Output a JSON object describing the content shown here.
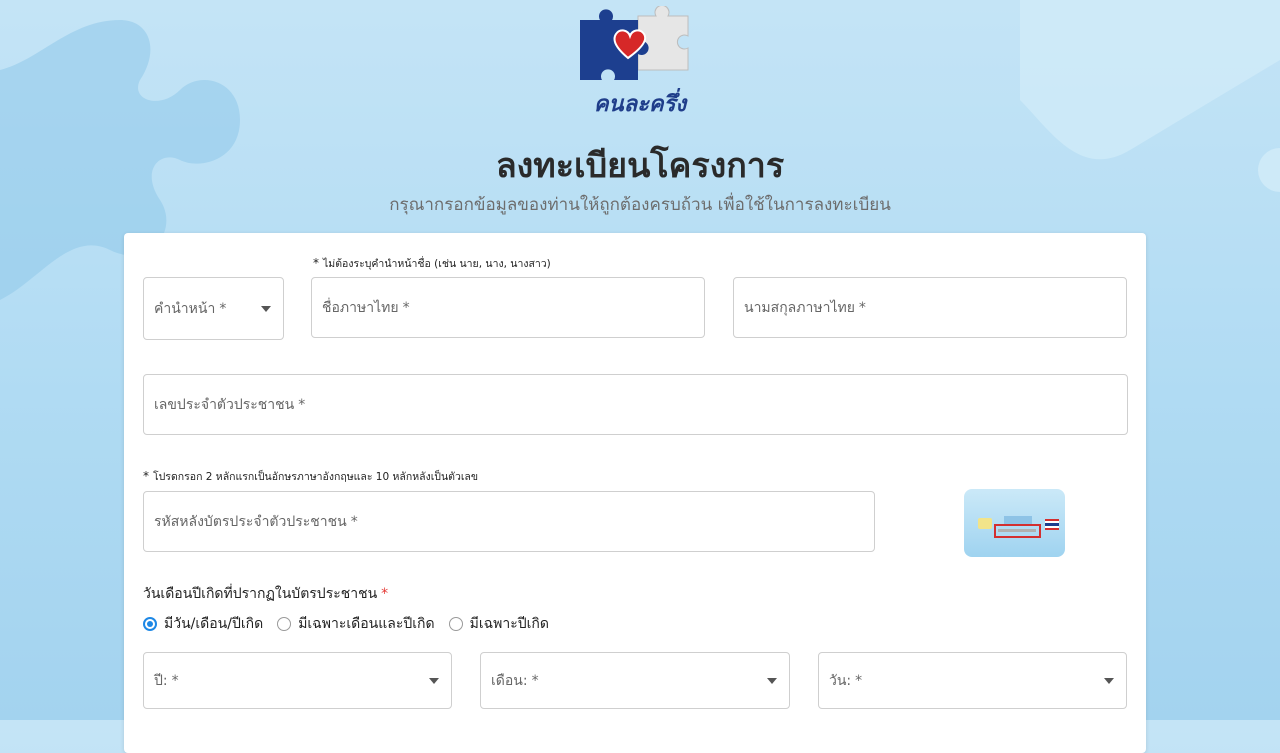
{
  "brand": {
    "name": "คนละครึ่ง"
  },
  "header": {
    "title": "ลงทะเบียนโครงการ",
    "subtitle": "กรุณากรอกข้อมูลของท่านให้ถูกต้องครบถ้วน เพื่อใช้ในการลงทะเบียน"
  },
  "form": {
    "name_hint": "ไม่ต้องระบุคำนำหน้าชื่อ (เช่น นาย, นาง, นางสาว)",
    "prefix": {
      "label": "คำนำหน้า",
      "required": "*"
    },
    "first_name": {
      "label": "ชื่อภาษาไทย",
      "required": "*"
    },
    "last_name": {
      "label": "นามสกุลภาษาไทย",
      "required": "*"
    },
    "citizen_id": {
      "label": "เลขประจำตัวประชาชน",
      "required": "*"
    },
    "laser_hint": "โปรดกรอก 2 หลักแรกเป็นอักษรภาษาอังกฤษและ 10 หลักหลังเป็นตัวเลข",
    "laser_code": {
      "label": "รหัสหลังบัตรประจำตัวประชาชน",
      "required": "*"
    },
    "dob_section": {
      "label": "วันเดือนปีเกิดที่ปรากฏในบัตรประชาชน",
      "required": "*"
    },
    "dob_options": [
      {
        "label": "มีวัน/เดือน/ปีเกิด",
        "checked": true
      },
      {
        "label": "มีเฉพาะเดือนและปีเกิด",
        "checked": false
      },
      {
        "label": "มีเฉพาะปีเกิด",
        "checked": false
      }
    ],
    "year": {
      "label": "ปี:",
      "required": "*"
    },
    "month": {
      "label": "เดือน:",
      "required": "*"
    },
    "day": {
      "label": "วัน:",
      "required": "*"
    },
    "hint_star": "*"
  },
  "colors": {
    "accent": "#1e88e5",
    "brand": "#1f3d8a",
    "required_star": "#e53935"
  }
}
